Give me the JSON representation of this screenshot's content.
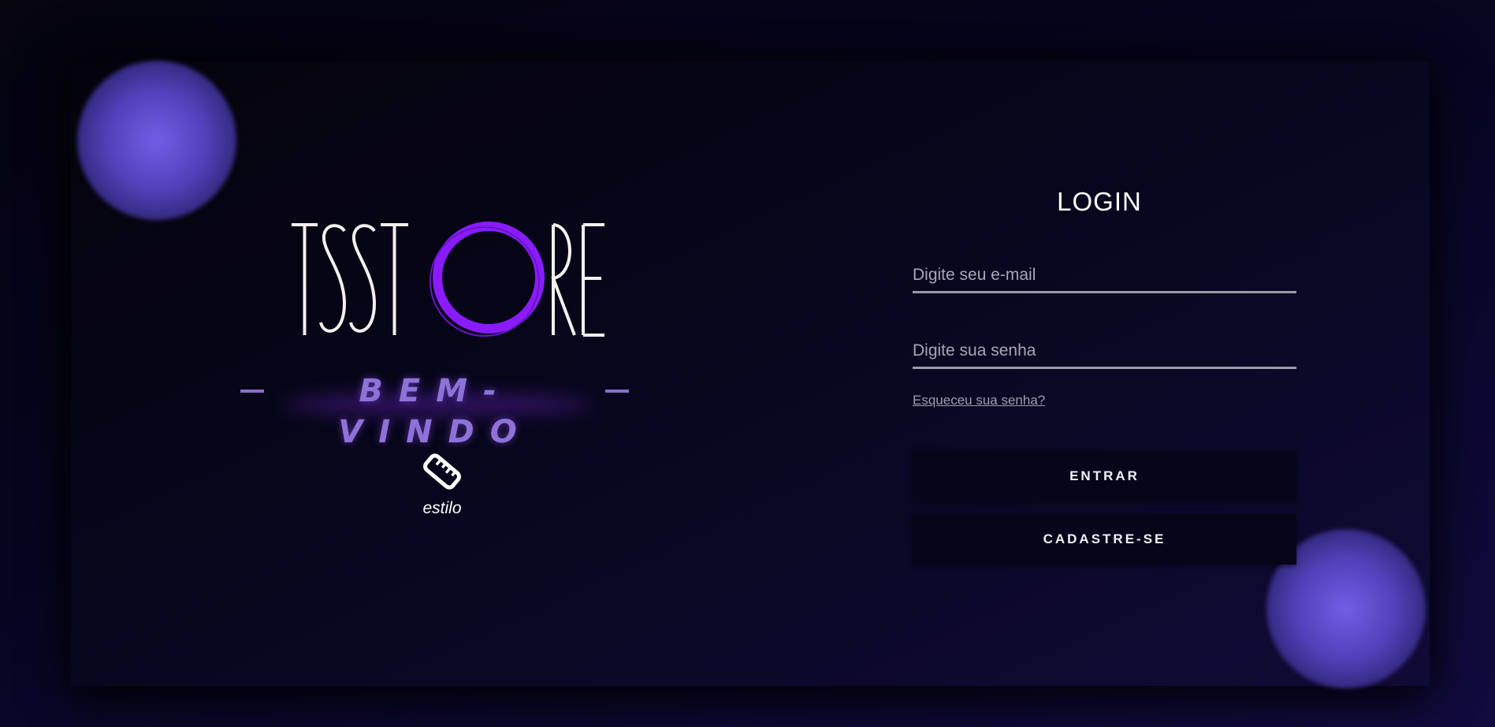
{
  "brand": {
    "logo_text": "TSSTORE",
    "welcome": "BEM-VINDO",
    "badge_icon": "ruler-icon",
    "badge_label": "estilo"
  },
  "login": {
    "title": "LOGIN",
    "email_placeholder": "Digite seu e-mail",
    "password_placeholder": "Digite sua senha",
    "forgot_link": "Esqueceu sua senha?",
    "enter_button": "ENTRAR",
    "signup_button": "CADASTRE-SE"
  },
  "colors": {
    "accent_purple": "#8a1bff",
    "orb": "#6f5fe6",
    "background": "#05040f"
  }
}
